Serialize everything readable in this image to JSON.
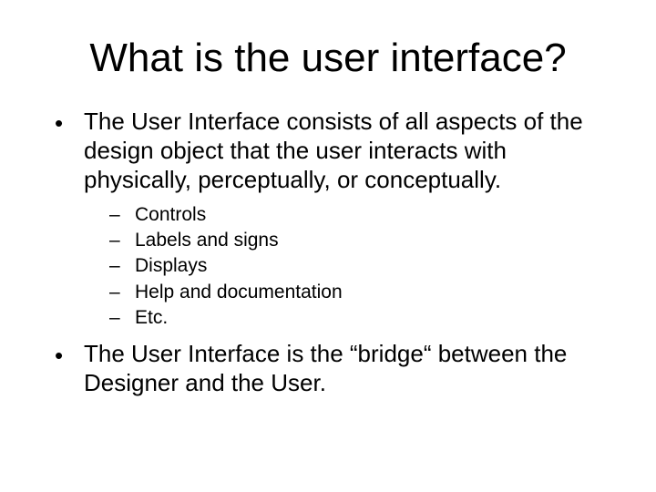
{
  "title": "What is the user interface?",
  "bullets": [
    "The User Interface consists of all aspects of the design object that the user interacts with physically, perceptually, or conceptually.",
    "The User Interface is the “bridge“ between the Designer and the User."
  ],
  "sub": [
    "Controls",
    "Labels and signs",
    "Displays",
    "Help and documentation",
    "Etc."
  ]
}
